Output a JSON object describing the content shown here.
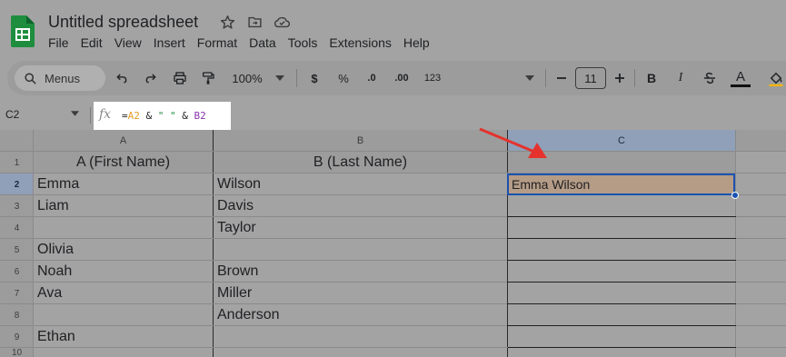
{
  "app": {
    "title": "Untitled spreadsheet",
    "menu": [
      "File",
      "Edit",
      "View",
      "Insert",
      "Format",
      "Data",
      "Tools",
      "Extensions",
      "Help"
    ]
  },
  "toolbar": {
    "search_label": "Menus",
    "zoom": "100%",
    "currency": "$",
    "percent": "%",
    "dec_decrease": ".0",
    "dec_increase": ".00",
    "number_format": "123",
    "font_size": "11",
    "bold": "B",
    "italic": "I",
    "text_color": "A"
  },
  "formula_bar": {
    "name_box": "C2",
    "fx": "fx",
    "formula_parts": [
      "=",
      "A2",
      " & ",
      "\" \"",
      " & ",
      "B2"
    ]
  },
  "columns": [
    "A",
    "B",
    "C"
  ],
  "rows": [
    "1",
    "2",
    "3",
    "4",
    "5",
    "6",
    "7",
    "8",
    "9",
    "10"
  ],
  "headers": {
    "a": "A (First Name)",
    "b": "B (Last Name)"
  },
  "cells": {
    "a": [
      "Emma",
      "Liam",
      "",
      "Olivia",
      "Noah",
      "Ava",
      "",
      "Ethan"
    ],
    "b": [
      "Wilson",
      "Davis",
      "Taylor",
      "",
      "Brown",
      "Miller",
      "Anderson",
      ""
    ],
    "c2": "Emma Wilson"
  },
  "colors": {
    "selection": "#1a52b0",
    "active_fill": "#b59c86",
    "arrow": "#e5322d"
  }
}
